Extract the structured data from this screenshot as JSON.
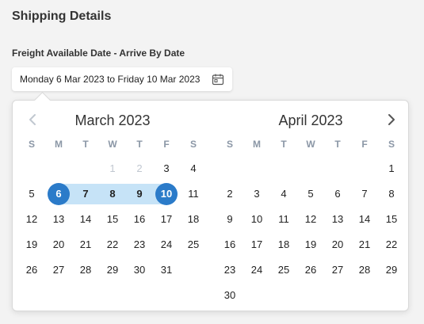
{
  "title": "Shipping Details",
  "field_label": "Freight Available Date - Arrive By Date",
  "date_input": {
    "value": "Monday 6 Mar 2023 to Friday 10 Mar 2023",
    "icon": "calendar-icon"
  },
  "weekdays": [
    "S",
    "M",
    "T",
    "W",
    "T",
    "F",
    "S"
  ],
  "months": [
    {
      "title": "March 2023",
      "first_weekday": 3,
      "days_in_month": 31,
      "disabled_days": [
        1,
        2
      ],
      "range_start": 6,
      "range_end": 10
    },
    {
      "title": "April 2023",
      "first_weekday": 6,
      "days_in_month": 30,
      "disabled_days": [],
      "range_start": null,
      "range_end": null
    }
  ],
  "colors": {
    "accent": "#2b7bc9",
    "range": "#c6e3f7",
    "weekday": "#8b97a6",
    "disabled": "#c0c7d0"
  }
}
